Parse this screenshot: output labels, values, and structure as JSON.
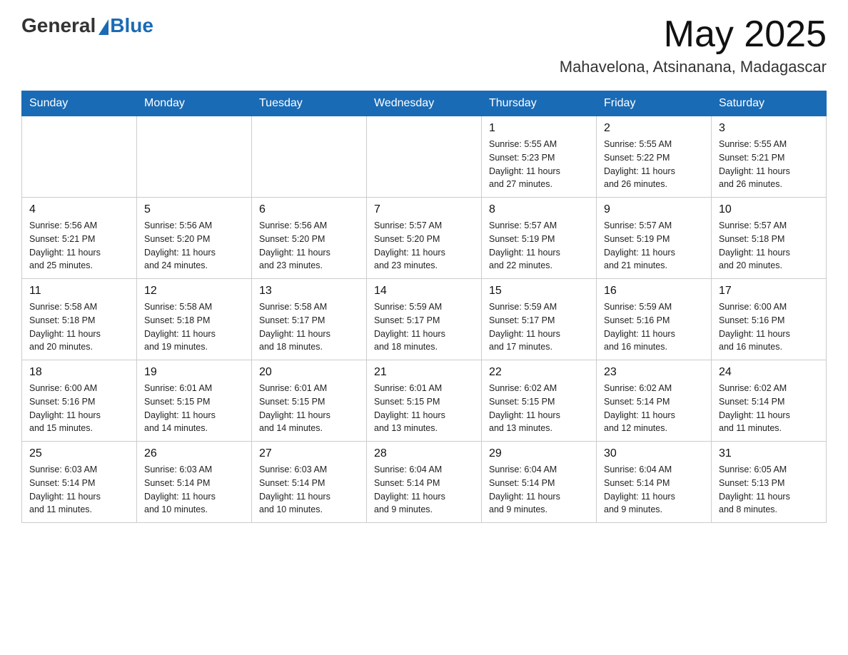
{
  "header": {
    "logo_general": "General",
    "logo_blue": "Blue",
    "month_year": "May 2025",
    "location": "Mahavelona, Atsinanana, Madagascar"
  },
  "days_of_week": [
    "Sunday",
    "Monday",
    "Tuesday",
    "Wednesday",
    "Thursday",
    "Friday",
    "Saturday"
  ],
  "weeks": [
    [
      {
        "day": "",
        "info": ""
      },
      {
        "day": "",
        "info": ""
      },
      {
        "day": "",
        "info": ""
      },
      {
        "day": "",
        "info": ""
      },
      {
        "day": "1",
        "info": "Sunrise: 5:55 AM\nSunset: 5:23 PM\nDaylight: 11 hours\nand 27 minutes."
      },
      {
        "day": "2",
        "info": "Sunrise: 5:55 AM\nSunset: 5:22 PM\nDaylight: 11 hours\nand 26 minutes."
      },
      {
        "day": "3",
        "info": "Sunrise: 5:55 AM\nSunset: 5:21 PM\nDaylight: 11 hours\nand 26 minutes."
      }
    ],
    [
      {
        "day": "4",
        "info": "Sunrise: 5:56 AM\nSunset: 5:21 PM\nDaylight: 11 hours\nand 25 minutes."
      },
      {
        "day": "5",
        "info": "Sunrise: 5:56 AM\nSunset: 5:20 PM\nDaylight: 11 hours\nand 24 minutes."
      },
      {
        "day": "6",
        "info": "Sunrise: 5:56 AM\nSunset: 5:20 PM\nDaylight: 11 hours\nand 23 minutes."
      },
      {
        "day": "7",
        "info": "Sunrise: 5:57 AM\nSunset: 5:20 PM\nDaylight: 11 hours\nand 23 minutes."
      },
      {
        "day": "8",
        "info": "Sunrise: 5:57 AM\nSunset: 5:19 PM\nDaylight: 11 hours\nand 22 minutes."
      },
      {
        "day": "9",
        "info": "Sunrise: 5:57 AM\nSunset: 5:19 PM\nDaylight: 11 hours\nand 21 minutes."
      },
      {
        "day": "10",
        "info": "Sunrise: 5:57 AM\nSunset: 5:18 PM\nDaylight: 11 hours\nand 20 minutes."
      }
    ],
    [
      {
        "day": "11",
        "info": "Sunrise: 5:58 AM\nSunset: 5:18 PM\nDaylight: 11 hours\nand 20 minutes."
      },
      {
        "day": "12",
        "info": "Sunrise: 5:58 AM\nSunset: 5:18 PM\nDaylight: 11 hours\nand 19 minutes."
      },
      {
        "day": "13",
        "info": "Sunrise: 5:58 AM\nSunset: 5:17 PM\nDaylight: 11 hours\nand 18 minutes."
      },
      {
        "day": "14",
        "info": "Sunrise: 5:59 AM\nSunset: 5:17 PM\nDaylight: 11 hours\nand 18 minutes."
      },
      {
        "day": "15",
        "info": "Sunrise: 5:59 AM\nSunset: 5:17 PM\nDaylight: 11 hours\nand 17 minutes."
      },
      {
        "day": "16",
        "info": "Sunrise: 5:59 AM\nSunset: 5:16 PM\nDaylight: 11 hours\nand 16 minutes."
      },
      {
        "day": "17",
        "info": "Sunrise: 6:00 AM\nSunset: 5:16 PM\nDaylight: 11 hours\nand 16 minutes."
      }
    ],
    [
      {
        "day": "18",
        "info": "Sunrise: 6:00 AM\nSunset: 5:16 PM\nDaylight: 11 hours\nand 15 minutes."
      },
      {
        "day": "19",
        "info": "Sunrise: 6:01 AM\nSunset: 5:15 PM\nDaylight: 11 hours\nand 14 minutes."
      },
      {
        "day": "20",
        "info": "Sunrise: 6:01 AM\nSunset: 5:15 PM\nDaylight: 11 hours\nand 14 minutes."
      },
      {
        "day": "21",
        "info": "Sunrise: 6:01 AM\nSunset: 5:15 PM\nDaylight: 11 hours\nand 13 minutes."
      },
      {
        "day": "22",
        "info": "Sunrise: 6:02 AM\nSunset: 5:15 PM\nDaylight: 11 hours\nand 13 minutes."
      },
      {
        "day": "23",
        "info": "Sunrise: 6:02 AM\nSunset: 5:14 PM\nDaylight: 11 hours\nand 12 minutes."
      },
      {
        "day": "24",
        "info": "Sunrise: 6:02 AM\nSunset: 5:14 PM\nDaylight: 11 hours\nand 11 minutes."
      }
    ],
    [
      {
        "day": "25",
        "info": "Sunrise: 6:03 AM\nSunset: 5:14 PM\nDaylight: 11 hours\nand 11 minutes."
      },
      {
        "day": "26",
        "info": "Sunrise: 6:03 AM\nSunset: 5:14 PM\nDaylight: 11 hours\nand 10 minutes."
      },
      {
        "day": "27",
        "info": "Sunrise: 6:03 AM\nSunset: 5:14 PM\nDaylight: 11 hours\nand 10 minutes."
      },
      {
        "day": "28",
        "info": "Sunrise: 6:04 AM\nSunset: 5:14 PM\nDaylight: 11 hours\nand 9 minutes."
      },
      {
        "day": "29",
        "info": "Sunrise: 6:04 AM\nSunset: 5:14 PM\nDaylight: 11 hours\nand 9 minutes."
      },
      {
        "day": "30",
        "info": "Sunrise: 6:04 AM\nSunset: 5:14 PM\nDaylight: 11 hours\nand 9 minutes."
      },
      {
        "day": "31",
        "info": "Sunrise: 6:05 AM\nSunset: 5:13 PM\nDaylight: 11 hours\nand 8 minutes."
      }
    ]
  ]
}
